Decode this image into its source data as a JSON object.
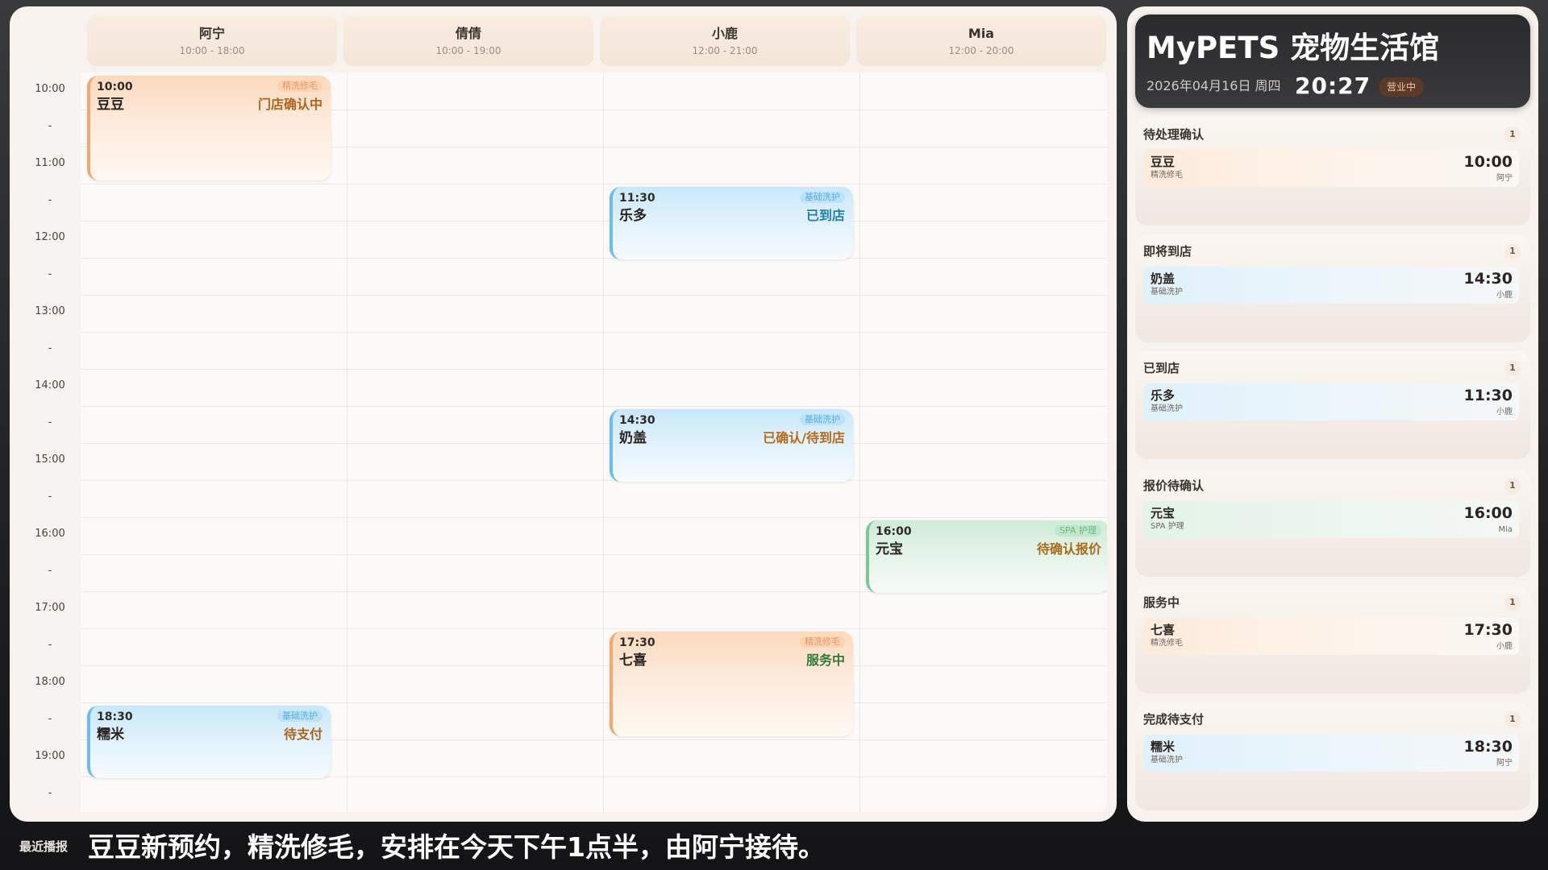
{
  "staff": [
    {
      "name": "阿宁",
      "hours": "10:00 - 18:00"
    },
    {
      "name": "倩倩",
      "hours": "10:00 - 19:00"
    },
    {
      "name": "小鹿",
      "hours": "12:00 - 21:00"
    },
    {
      "name": "Mia",
      "hours": "12:00 - 20:00"
    }
  ],
  "time_labels": [
    "10:00",
    "-",
    "11:00",
    "-",
    "12:00",
    "-",
    "13:00",
    "-",
    "14:00",
    "-",
    "15:00",
    "-",
    "16:00",
    "-",
    "17:00",
    "-",
    "18:00",
    "-",
    "19:00",
    "-"
  ],
  "appointments": [
    {
      "staff": "阿宁",
      "time": "10:00",
      "pet": "豆豆",
      "service": "精洗修毛",
      "status": "门店确认中",
      "status_color": "#b5621e",
      "type": "grooming"
    },
    {
      "staff": "小鹿",
      "time": "11:30",
      "pet": "乐多",
      "service": "基础洗护",
      "status": "已到店",
      "status_color": "#1f7fae",
      "type": "basic"
    },
    {
      "staff": "小鹿",
      "time": "14:30",
      "pet": "奶盖",
      "service": "基础洗护",
      "status": "已确认/待到店",
      "status_color": "#b86a1c",
      "type": "basic"
    },
    {
      "staff": "Mia",
      "time": "16:00",
      "pet": "元宝",
      "service": "SPA 护理",
      "status": "待确认报价",
      "status_color": "#a86a1a",
      "type": "spa"
    },
    {
      "staff": "小鹿",
      "time": "17:30",
      "pet": "七喜",
      "service": "精洗修毛",
      "status": "服务中",
      "status_color": "#2f7a3a",
      "type": "grooming"
    },
    {
      "staff": "阿宁",
      "time": "18:30",
      "pet": "糯米",
      "service": "基础洗护",
      "status": "待支付",
      "status_color": "#a8641a",
      "type": "basic"
    }
  ],
  "store": {
    "name": "MyPETS 宠物生活馆",
    "date": "2026年04月16日 周四",
    "clock": "20:27",
    "status": "营业中"
  },
  "queues": [
    {
      "title": "待处理确认",
      "count": "1",
      "items": [
        {
          "pet": "豆豆",
          "service": "精洗修毛",
          "time": "10:00",
          "staff": "阿宁",
          "type": "grooming"
        }
      ]
    },
    {
      "title": "即将到店",
      "count": "1",
      "items": [
        {
          "pet": "奶盖",
          "service": "基础洗护",
          "time": "14:30",
          "staff": "小鹿",
          "type": "basic"
        }
      ]
    },
    {
      "title": "已到店",
      "count": "1",
      "items": [
        {
          "pet": "乐多",
          "service": "基础洗护",
          "time": "11:30",
          "staff": "小鹿",
          "type": "basic"
        }
      ]
    },
    {
      "title": "报价待确认",
      "count": "1",
      "items": [
        {
          "pet": "元宝",
          "service": "SPA 护理",
          "time": "16:00",
          "staff": "Mia",
          "type": "spa"
        }
      ]
    },
    {
      "title": "服务中",
      "count": "1",
      "items": [
        {
          "pet": "七喜",
          "service": "精洗修毛",
          "time": "17:30",
          "staff": "小鹿",
          "type": "grooming"
        }
      ]
    },
    {
      "title": "完成待支付",
      "count": "1",
      "items": [
        {
          "pet": "糯米",
          "service": "基础洗护",
          "time": "18:30",
          "staff": "阿宁",
          "type": "basic"
        }
      ]
    }
  ],
  "ticker": {
    "label": "最近播报",
    "text": "豆豆新预约，精洗修毛，安排在今天下午1点半，由阿宁接待。"
  }
}
